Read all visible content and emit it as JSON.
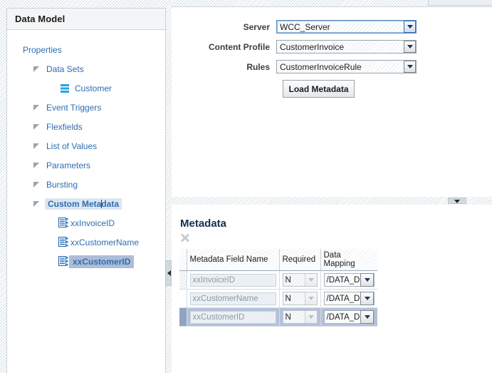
{
  "left_panel": {
    "title": "Data Model",
    "tree": [
      {
        "label": "Properties",
        "level": 0,
        "icon": "none",
        "state": "normal"
      },
      {
        "label": "Data Sets",
        "level": 1,
        "icon": "disclosure",
        "state": "normal"
      },
      {
        "label": "Customer",
        "level": 2,
        "icon": "dataset-icon",
        "state": "normal"
      },
      {
        "label": "Event Triggers",
        "level": 1,
        "icon": "disclosure",
        "state": "normal"
      },
      {
        "label": "Flexfields",
        "level": 1,
        "icon": "disclosure",
        "state": "normal"
      },
      {
        "label": "List of Values",
        "level": 1,
        "icon": "disclosure",
        "state": "normal"
      },
      {
        "label": "Parameters",
        "level": 1,
        "icon": "disclosure",
        "state": "normal"
      },
      {
        "label": "Bursting",
        "level": 1,
        "icon": "disclosure",
        "state": "normal"
      },
      {
        "label": "Custom Metadata",
        "level": 1,
        "icon": "disclosure",
        "state": "focused"
      },
      {
        "label": "xxInvoiceID",
        "level": 3,
        "icon": "metadata-icon",
        "state": "normal"
      },
      {
        "label": "xxCustomerName",
        "level": 3,
        "icon": "metadata-icon",
        "state": "normal"
      },
      {
        "label": "xxCustomerID",
        "level": 3,
        "icon": "metadata-icon",
        "state": "selected"
      }
    ]
  },
  "form": {
    "rows": [
      {
        "label": "Server",
        "value": "WCC_Server",
        "focused": true
      },
      {
        "label": "Content Profile",
        "value": "CustomerInvoice",
        "focused": false
      },
      {
        "label": "Rules",
        "value": "CustomerInvoiceRule",
        "focused": false
      }
    ],
    "load_button_label": "Load Metadata"
  },
  "metadata": {
    "title": "Metadata",
    "delete_icon": "close-x-icon",
    "columns": [
      "Metadata Field Name",
      "Required",
      "Data Mapping"
    ],
    "rows": [
      {
        "field_name": "xxInvoiceID",
        "required": "N",
        "data_mapping": "/DATA_D",
        "selected": false
      },
      {
        "field_name": "xxCustomerName",
        "required": "N",
        "data_mapping": "/DATA_D",
        "selected": false
      },
      {
        "field_name": "xxCustomerID",
        "required": "N",
        "data_mapping": "/DATA_D",
        "selected": true
      }
    ]
  },
  "splitters": {
    "vertical_handle_icon": "collapse-left-arrow-icon",
    "horizontal_handle_icon": "collapse-down-arrow-icon"
  },
  "colors": {
    "accent": "#2f6cb0",
    "selection": "#b3c2da",
    "focus_outline": "#5b8ec4",
    "panel_border": "#c8d3da"
  }
}
